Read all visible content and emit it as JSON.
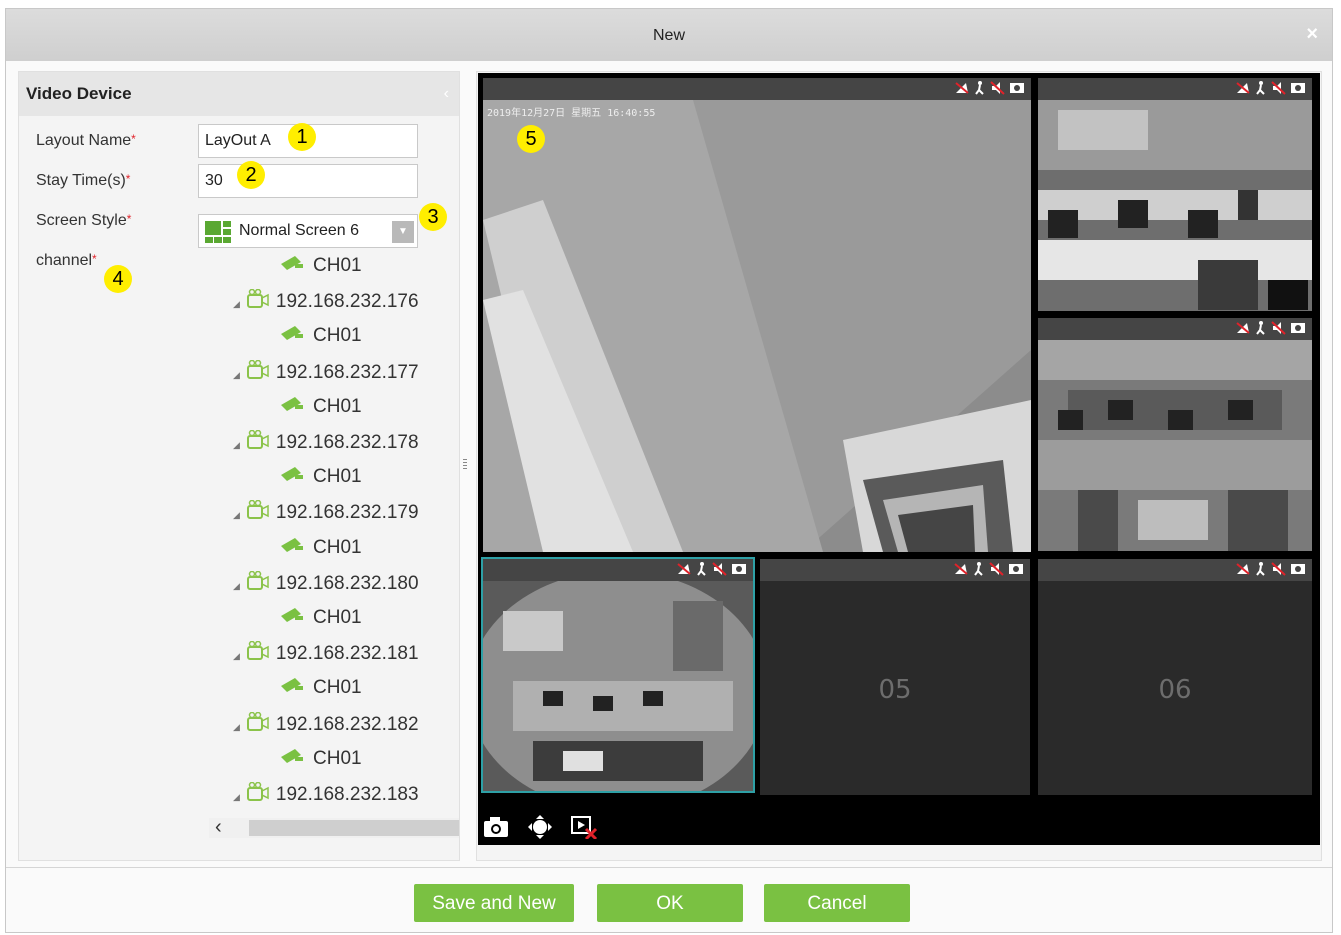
{
  "dialog": {
    "title": "New",
    "close_glyph": "×"
  },
  "left_panel": {
    "title": "Video Device",
    "collapse_glyph": "‹",
    "layout_name": {
      "label": "Layout Name",
      "value": "LayOut A"
    },
    "stay_time": {
      "label": "Stay Time(s)",
      "value": "30"
    },
    "screen_style": {
      "label": "Screen Style",
      "value": "Normal Screen 6"
    },
    "channel": {
      "label": "channel"
    },
    "required_mark": "*",
    "tree": [
      {
        "type": "channel",
        "label": "CH01"
      },
      {
        "type": "device",
        "label": "192.168.232.176"
      },
      {
        "type": "channel",
        "label": "CH01"
      },
      {
        "type": "device",
        "label": "192.168.232.177"
      },
      {
        "type": "channel",
        "label": "CH01"
      },
      {
        "type": "device",
        "label": "192.168.232.178"
      },
      {
        "type": "channel",
        "label": "CH01"
      },
      {
        "type": "device",
        "label": "192.168.232.179"
      },
      {
        "type": "channel",
        "label": "CH01"
      },
      {
        "type": "device",
        "label": "192.168.232.180"
      },
      {
        "type": "channel",
        "label": "CH01"
      },
      {
        "type": "device",
        "label": "192.168.232.181"
      },
      {
        "type": "channel",
        "label": "CH01"
      },
      {
        "type": "device",
        "label": "192.168.232.182"
      },
      {
        "type": "channel",
        "label": "CH01"
      },
      {
        "type": "device",
        "label": "192.168.232.183"
      }
    ],
    "scroll_left_glyph": "‹"
  },
  "badges": [
    "1",
    "2",
    "3",
    "4",
    "5"
  ],
  "video": {
    "timestamp": "2019年12月27日 星期五 16:40:55",
    "empty_tiles": [
      "05",
      "06"
    ]
  },
  "buttons": {
    "save_and_new": "Save and New",
    "ok": "OK",
    "cancel": "Cancel"
  },
  "colors": {
    "accent_green": "#7ac142",
    "required_red": "#e0222a",
    "badge_yellow": "#ffee00"
  }
}
